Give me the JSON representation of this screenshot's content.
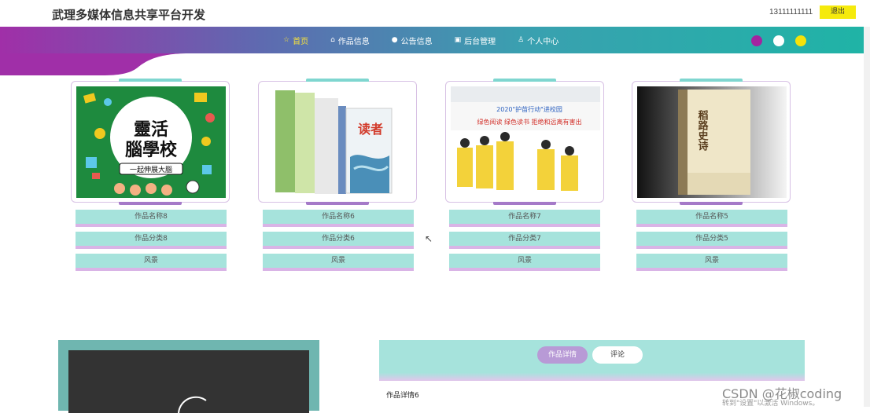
{
  "header": {
    "title": "武理多媒体信息共享平台开发",
    "user_phone": "13111111111",
    "logout_label": "退出"
  },
  "nav": {
    "items": [
      {
        "label": "首页",
        "icon": "star-icon",
        "glyph": "☆",
        "active": true
      },
      {
        "label": "作品信息",
        "icon": "home-icon",
        "glyph": "⌂",
        "active": false
      },
      {
        "label": "公告信息",
        "icon": "circle-icon",
        "glyph": "●",
        "active": false
      },
      {
        "label": "后台管理",
        "icon": "box-icon",
        "glyph": "▣",
        "active": false
      },
      {
        "label": "个人中心",
        "icon": "user-icon",
        "glyph": "♙",
        "active": false
      }
    ],
    "theme_colors": [
      "#a324a0",
      "#ffffff",
      "#f5e20a"
    ]
  },
  "works": [
    {
      "name": "作品名称8",
      "category": "作品分类8",
      "type": "风景",
      "image": "clever-brain-school-poster"
    },
    {
      "name": "作品名称6",
      "category": "作品分类6",
      "type": "风景",
      "image": "magazines-stack"
    },
    {
      "name": "作品名称7",
      "category": "作品分类7",
      "type": "风景",
      "image": "students-signing-banner"
    },
    {
      "name": "作品名称5",
      "category": "作品分类5",
      "type": "风景",
      "image": "book-cover"
    }
  ],
  "poster_texts": {
    "card1_line1": "靈活",
    "card1_line2": "腦學校",
    "card1_sub": "一起伸展大腦",
    "card2_magazine": "读者",
    "card3_banner": "2020\"护苗行动\"进校园",
    "card3_sub": "绿色阅读 绿色读书 拒绝和远离有害出",
    "card4_title": "稻路史诗"
  },
  "detail": {
    "tab_detail": "作品详情",
    "tab_comment": "评论",
    "content": "作品详情6"
  },
  "watermark": {
    "text": "CSDN @花椒coding",
    "activate": "转到\"设置\"以激活 Windows。"
  }
}
